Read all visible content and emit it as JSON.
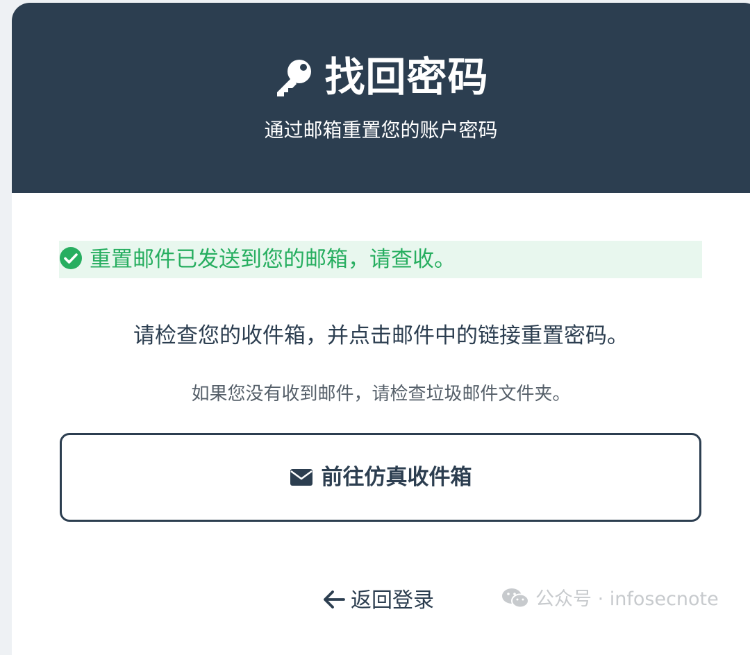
{
  "header": {
    "icon": "key-icon",
    "title": "找回密码",
    "subtitle": "通过邮箱重置您的账户密码",
    "background_color": "#2c3e50"
  },
  "alert": {
    "icon": "check-circle-icon",
    "text": "重置邮件已发送到您的邮箱，请查收。",
    "text_color": "#27ae60",
    "background_color": "#e8f7ee"
  },
  "body": {
    "main_text": "请检查您的收件箱，并点击邮件中的链接重置密码。",
    "sub_text": "如果您没有收到邮件，请检查垃圾邮件文件夹。"
  },
  "inbox_button": {
    "icon": "envelope-icon",
    "label": "前往仿真收件箱"
  },
  "back_link": {
    "icon": "arrow-left-icon",
    "label": "返回登录"
  },
  "watermark": {
    "icon": "wechat-icon",
    "text": "公众号 · infosecnote"
  }
}
